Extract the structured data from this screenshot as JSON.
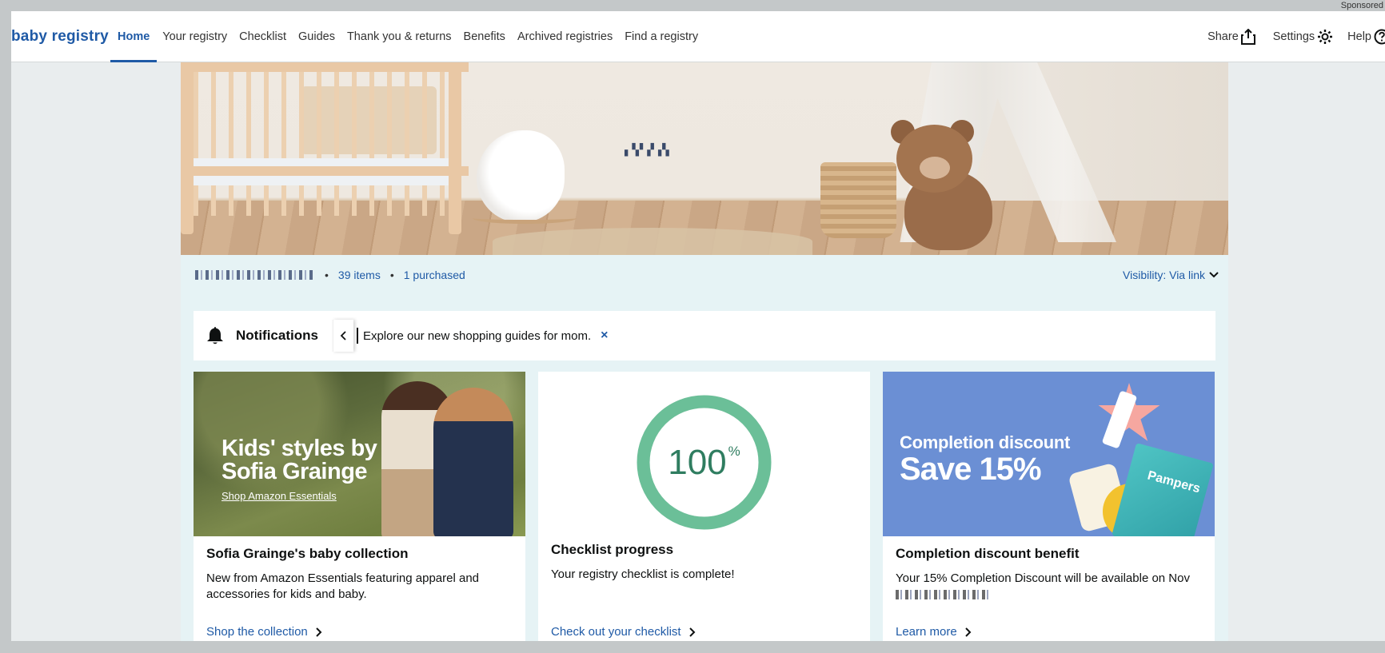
{
  "sponsored_label": "Sponsored",
  "nav": {
    "brand": "baby registry",
    "tabs": [
      {
        "label": "Home",
        "active": true
      },
      {
        "label": "Your registry"
      },
      {
        "label": "Checklist"
      },
      {
        "label": "Guides"
      },
      {
        "label": "Thank you & returns"
      },
      {
        "label": "Benefits"
      },
      {
        "label": "Archived registries"
      },
      {
        "label": "Find a registry"
      }
    ],
    "share": "Share",
    "settings": "Settings",
    "help": "Help"
  },
  "banner": {
    "registrant_name": "▖▚▘▞▗▚"
  },
  "info_bar": {
    "items_count": "39 items",
    "purchased": "1 purchased",
    "visibility": "Visibility: Via link"
  },
  "notifications": {
    "title": "Notifications",
    "message": "Explore our new shopping guides for mom.",
    "close": "×"
  },
  "cards": [
    {
      "image_headline": "Kids' styles by Sofia Grainge",
      "image_subline": "Shop Amazon Essentials",
      "title": "Sofia Grainge's baby collection",
      "description": "New from Amazon Essentials featuring apparel and accessories for kids and baby.",
      "link": "Shop the collection"
    },
    {
      "progress_value": "100",
      "progress_unit": "%",
      "progress_fraction": 1.0,
      "title": "Checklist progress",
      "description": "Your registry checklist is complete!",
      "link": "Check out your checklist"
    },
    {
      "image_line1": "Completion discount",
      "image_line2": "Save 15%",
      "image_brand": "Pampers",
      "title": "Completion discount benefit",
      "description": "Your 15% Completion Discount will be available on Nov",
      "link": "Learn more"
    }
  ],
  "colors": {
    "accent": "#1f5aa6",
    "progress_ring": "#6bbf98",
    "card3_bg": "#6b8fd4"
  }
}
